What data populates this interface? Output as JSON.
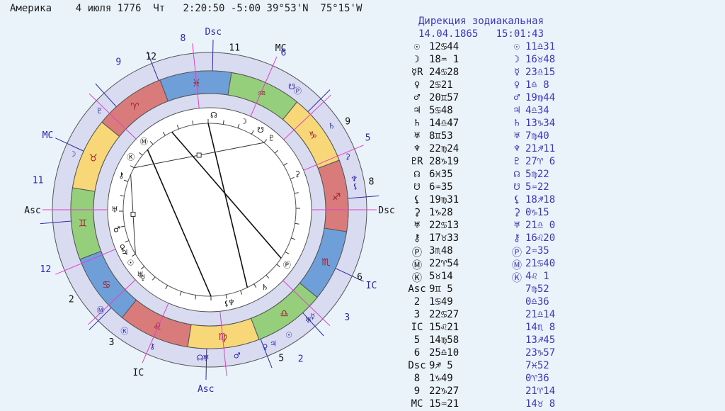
{
  "header": {
    "location": "Америка",
    "date": "4 июля 1776",
    "weekday": "Чт",
    "time": "2:20:50",
    "tz": "-5:00",
    "lat": "39°53'N",
    "lon": "75°15'W"
  },
  "direction": {
    "title": "Дирекция зодиакальная",
    "date": "14.04.1865   15:01:43"
  },
  "colors": {
    "background": "#eaf2fa",
    "ring_fill": "#d9dcf0",
    "fire": "#d97b7b",
    "earth": "#f7d777",
    "air": "#96cf7c",
    "water": "#6f9fd8",
    "house_line_natal": "#e040c8",
    "house_line_direction": "#2a2aa8",
    "aspect_line": "#111111",
    "direction_text": "#3a3ab8"
  },
  "zodiac_signs": [
    "♈",
    "♉",
    "♊",
    "♋",
    "♌",
    "♍",
    "♎",
    "♏",
    "♐",
    "♑",
    "♒",
    "♓"
  ],
  "zodiac_colors": [
    "fire",
    "earth",
    "air",
    "water",
    "fire",
    "earth",
    "air",
    "water",
    "fire",
    "earth",
    "air",
    "water"
  ],
  "wheel_labels": {
    "natal_axes": [
      {
        "text": "Asc"
      },
      {
        "text": "Dsc"
      },
      {
        "text": "MC"
      },
      {
        "text": "IC"
      }
    ],
    "direction_axes": [
      {
        "text": "Asc"
      },
      {
        "text": "Dsc"
      },
      {
        "text": "MC"
      },
      {
        "text": "IC"
      }
    ],
    "natal_house_numbers": [
      "11",
      "12",
      "2",
      "3",
      "5",
      "6",
      "8",
      "9"
    ],
    "direction_house_numbers": [
      "11",
      "12",
      "2",
      "3",
      "5",
      "6",
      "8",
      "9"
    ]
  },
  "rows": [
    {
      "label": "☉",
      "v1": "12♋44",
      "sym": "☉",
      "v2": "11♎31"
    },
    {
      "label": "☽",
      "v1": "18♒ 1",
      "sym": "☽",
      "v2": "16♉48"
    },
    {
      "label": "☿R",
      "v1": "24♋28",
      "sym": "☿",
      "v2": "23♎15"
    },
    {
      "label": "♀",
      "v1": "2♋21",
      "sym": "♀",
      "v2": "1♎ 8"
    },
    {
      "label": "♂",
      "v1": "20♊57",
      "sym": "♂",
      "v2": "19♍44"
    },
    {
      "label": "♃",
      "v1": "5♋48",
      "sym": "♃",
      "v2": "4♎34"
    },
    {
      "label": "♄",
      "v1": "14♎47",
      "sym": "♄",
      "v2": "13♑34"
    },
    {
      "label": "♅",
      "v1": "8♊53",
      "sym": "♅",
      "v2": "7♍40"
    },
    {
      "label": "♆",
      "v1": "22♍24",
      "sym": "♆",
      "v2": "21♐11"
    },
    {
      "label": "♇R",
      "v1": "28♑19",
      "sym": "♇",
      "v2": "27♈ 6"
    },
    {
      "label": "☊",
      "v1": "6♓35",
      "sym": "☊",
      "v2": "5♍22"
    },
    {
      "label": "☋",
      "v1": "6♒35",
      "sym": "☋",
      "v2": "5♒22"
    },
    {
      "label": "⚸",
      "v1": "19♍31",
      "sym": "⚸",
      "v2": "18♐18"
    },
    {
      "label": "⚳",
      "v1": "1♑28",
      "sym": "⚳",
      "v2": "0♑15"
    },
    {
      "label": "♅",
      "v1": "22♋13",
      "sym": "♅",
      "v2": "21♎ 0"
    },
    {
      "label": "⚷",
      "v1": "17♉33",
      "sym": "⚷",
      "v2": "16♌20"
    },
    {
      "label": "Ⓟ",
      "v1": "3♏48",
      "sym": "Ⓟ",
      "v2": "2♒35"
    },
    {
      "label": "Ⓜ",
      "v1": "22♈54",
      "sym": "Ⓜ",
      "v2": "21♋40"
    },
    {
      "label": "Ⓚ",
      "v1": "5♉14",
      "sym": "Ⓚ",
      "v2": "4♌ 1"
    },
    {
      "label": "Asc",
      "v1": "9♊ 5",
      "sym": "",
      "v2": "7♍52"
    },
    {
      "label": "2",
      "v1": "1♋49",
      "sym": "",
      "v2": "0♎36"
    },
    {
      "label": "3",
      "v1": "22♋27",
      "sym": "",
      "v2": "21♎14"
    },
    {
      "label": "IC",
      "v1": "15♌21",
      "sym": "",
      "v2": "14♏ 8"
    },
    {
      "label": "5",
      "v1": "14♍58",
      "sym": "",
      "v2": "13♐45"
    },
    {
      "label": "6",
      "v1": "25♎10",
      "sym": "",
      "v2": "23♑57"
    },
    {
      "label": "Dsc",
      "v1": "9♐ 5",
      "sym": "",
      "v2": "7♓52"
    },
    {
      "label": "8",
      "v1": "1♑49",
      "sym": "",
      "v2": "0♈36"
    },
    {
      "label": "9",
      "v1": "22♑27",
      "sym": "",
      "v2": "21♈14"
    },
    {
      "label": "MC",
      "v1": "15♒21",
      "sym": "",
      "v2": "14♉ 8"
    }
  ]
}
